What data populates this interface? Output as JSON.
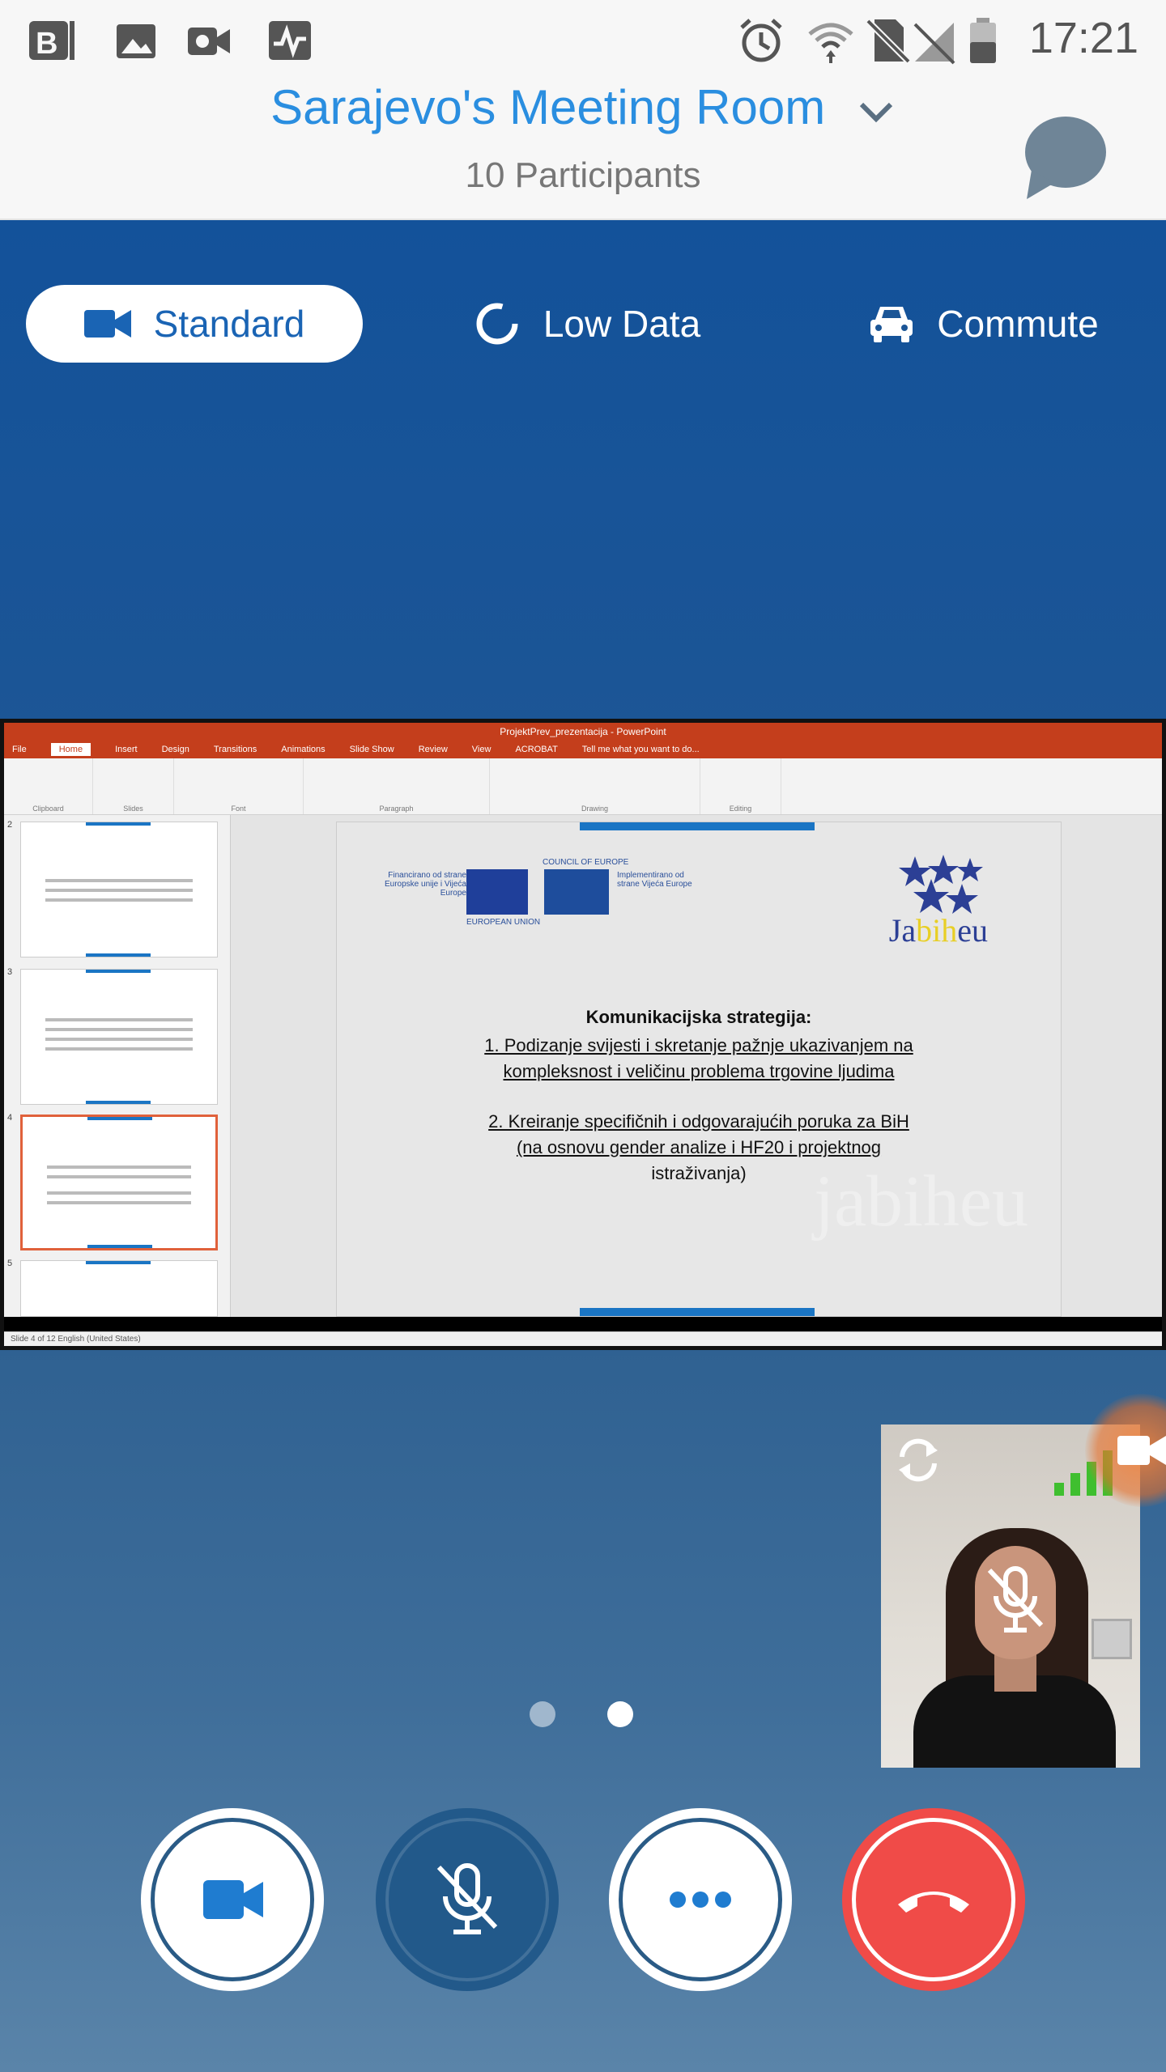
{
  "status_bar": {
    "time": "17:21",
    "left_icons": [
      "b-notification-icon",
      "image-icon",
      "video-icon",
      "activity-icon"
    ],
    "right_icons": [
      "alarm-icon",
      "wifi-icon",
      "sim-off-icon",
      "signal-off-icon",
      "battery-icon"
    ]
  },
  "header": {
    "title": "Sarajevo's Meeting Room",
    "participants": "10 Participants"
  },
  "modes": {
    "standard": "Standard",
    "low_data": "Low Data",
    "commute": "Commute"
  },
  "shared_screen": {
    "window_title": "ProjektPrev_prezentacija - PowerPoint",
    "tabs": [
      "File",
      "Home",
      "Insert",
      "Design",
      "Transitions",
      "Animations",
      "Slide Show",
      "Review",
      "View",
      "ACROBAT",
      "Tell me what you want to do..."
    ],
    "ribbon_groups": [
      "Clipboard",
      "Slides",
      "Font",
      "Paragraph",
      "Drawing",
      "Editing"
    ],
    "thumbnail_numbers": [
      "2",
      "3",
      "4",
      "5"
    ],
    "slide": {
      "funding_left": "Financirano od strane Europske unije i Vijeća Europe",
      "eu_label": "EUROPEAN UNION",
      "coe_label": "COUNCIL OF EUROPE",
      "funding_right": "Implementirano od strane Vijeća Europe",
      "logo_prefix": "Ja",
      "logo_mid": "bih",
      "logo_suffix": "eu",
      "heading": "Komunikacijska strategija:",
      "point1_line1": "1.   Podizanje svijesti i skretanje pažnje ukazivanjem na",
      "point1_line2": "kompleksnost i veličinu problema trgovine ljudima",
      "point2_line1": "2. Kreiranje  specifičnih i odgovarajućih poruka za BiH",
      "point2_line2": "(na osnovu gender analize i HF20  i projektnog",
      "point2_line3": "istraživanja)",
      "watermark": "jabiheu"
    },
    "status": "Slide 4 of 12     English (United States)"
  },
  "pager": {
    "current": 2,
    "total": 2
  },
  "colors": {
    "accent": "#2a8ee0",
    "bg_top": "#13529a",
    "hangup": "#f04b48",
    "ppt": "#c43e1c"
  },
  "controls": [
    "video-button",
    "mute-button",
    "more-button",
    "hang-up-button"
  ]
}
